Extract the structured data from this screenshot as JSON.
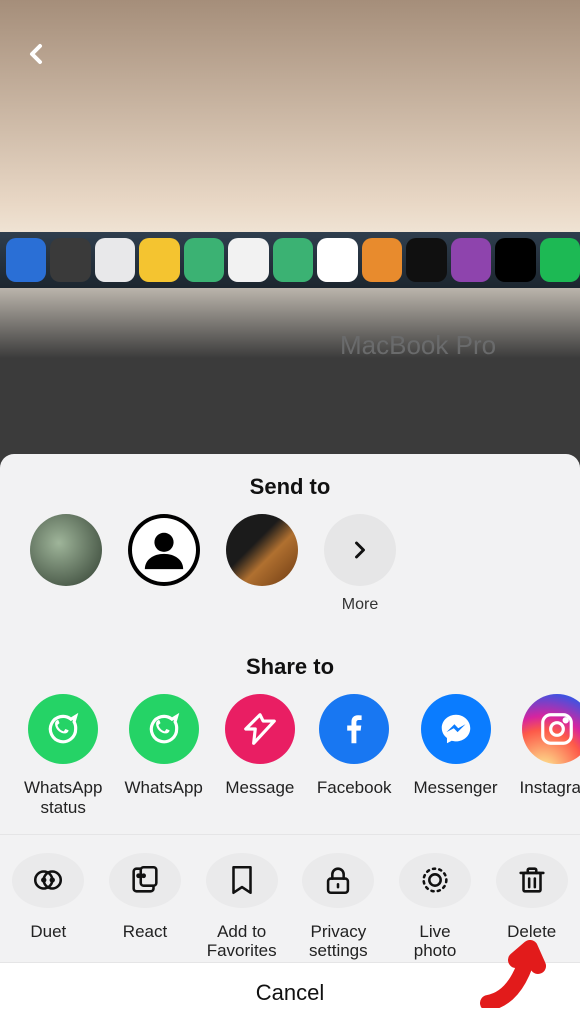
{
  "header": {
    "back_icon": "back"
  },
  "video": {
    "device_label": "MacBook Pro"
  },
  "sheet": {
    "send_title": "Send to",
    "share_title": "Share to",
    "cancel_label": "Cancel",
    "more_label": "More",
    "contacts": [
      {
        "name": " "
      },
      {
        "name": " "
      },
      {
        "name": " "
      }
    ],
    "share_targets": [
      {
        "label": "WhatsApp status",
        "color": "#25D366",
        "icon": "whatsapp"
      },
      {
        "label": "WhatsApp",
        "color": "#25D366",
        "icon": "whatsapp"
      },
      {
        "label": "Message",
        "color": "#E91E63",
        "icon": "send"
      },
      {
        "label": "Facebook",
        "color": "#1877F2",
        "icon": "facebook"
      },
      {
        "label": "Messenger",
        "color": "#0A7CFF",
        "icon": "messenger"
      },
      {
        "label": "Instagram",
        "color": "instagram",
        "icon": "instagram"
      }
    ],
    "actions": [
      {
        "label": "Duet",
        "icon": "duet"
      },
      {
        "label": "React",
        "icon": "react"
      },
      {
        "label": "Add to Favorites",
        "icon": "bookmark"
      },
      {
        "label": "Privacy settings",
        "icon": "lock"
      },
      {
        "label": "Live photo",
        "icon": "livephoto"
      },
      {
        "label": "Delete",
        "icon": "trash"
      }
    ]
  },
  "dock_colors": [
    "#2a6fd6",
    "#3a3a3a",
    "#e8e8ea",
    "#f4c430",
    "#3bb273",
    "#f2f2f2",
    "#3bb273",
    "#ffffff",
    "#e88b2d",
    "#101010",
    "#8e44ad",
    "#000000",
    "#1db954"
  ]
}
